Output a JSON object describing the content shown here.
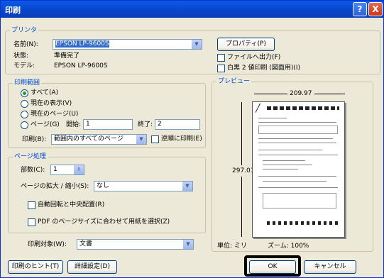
{
  "window": {
    "title": "印刷",
    "help_glyph": "?",
    "close_glyph": "X"
  },
  "printer": {
    "legend": "プリンタ",
    "name_label": "名前(N):",
    "name_value": "EPSON LP-9600S",
    "properties_button": "プロパティ(P)",
    "status_label": "状態:",
    "status_value": "準備完了",
    "model_label": "モデル:",
    "model_value": "EPSON LP-9600S",
    "print_to_file": "ファイルへ出力(F)",
    "two_tone": "白黒 2 値印刷 (図面用)(I)"
  },
  "range": {
    "legend": "印刷範囲",
    "all": "すべて(A)",
    "current_view": "現在の表示(V)",
    "current_page": "現在のページ(U)",
    "pages": "ページ(G)",
    "start_label": "開始:",
    "start_value": "1",
    "end_label": "終了:",
    "end_value": "2",
    "print_label": "印刷(B):",
    "print_value": "範囲内のすべてのページ",
    "reverse": "逆順に印刷(E)"
  },
  "handling": {
    "legend": "ページ処理",
    "copies_label": "部数(C):",
    "copies_value": "1",
    "scaling_label": "ページの拡大 / 縮小(S):",
    "scaling_value": "なし",
    "auto_rotate": "自動回転と中央配置(R)",
    "pdf_paper": "PDF のページサイズに合わせて用紙を選択(Z)"
  },
  "print_what": {
    "label": "印刷対象(W):",
    "value": "文書"
  },
  "preview": {
    "legend": "プレビュー",
    "width": "209.97",
    "height": "297.01",
    "units": "単位: ミリ",
    "zoom": "ズーム: 100%"
  },
  "footer": {
    "tips_button": "印刷のヒント(T)",
    "advanced_button": "詳細設定(D)",
    "ok_button": "OK",
    "cancel_button": "キャンセル"
  }
}
